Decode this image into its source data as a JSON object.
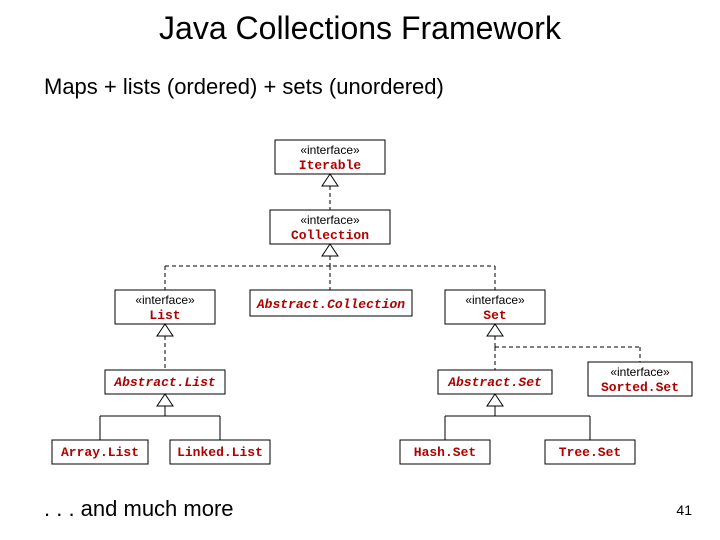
{
  "title": "Java Collections Framework",
  "subtitle": "Maps + lists (ordered) + sets (unordered)",
  "footer": ". . . and much more",
  "page": "41",
  "stereotype": "«interface»",
  "nodes": {
    "iterable": "Iterable",
    "collection": "Collection",
    "list": "List",
    "abstractCollection": "Abstract.Collection",
    "set": "Set",
    "abstractList": "Abstract.List",
    "abstractSet": "Abstract.Set",
    "sortedSet": "Sorted.Set",
    "arrayList": "Array.List",
    "linkedList": "Linked.List",
    "hashSet": "Hash.Set",
    "treeSet": "Tree.Set"
  }
}
